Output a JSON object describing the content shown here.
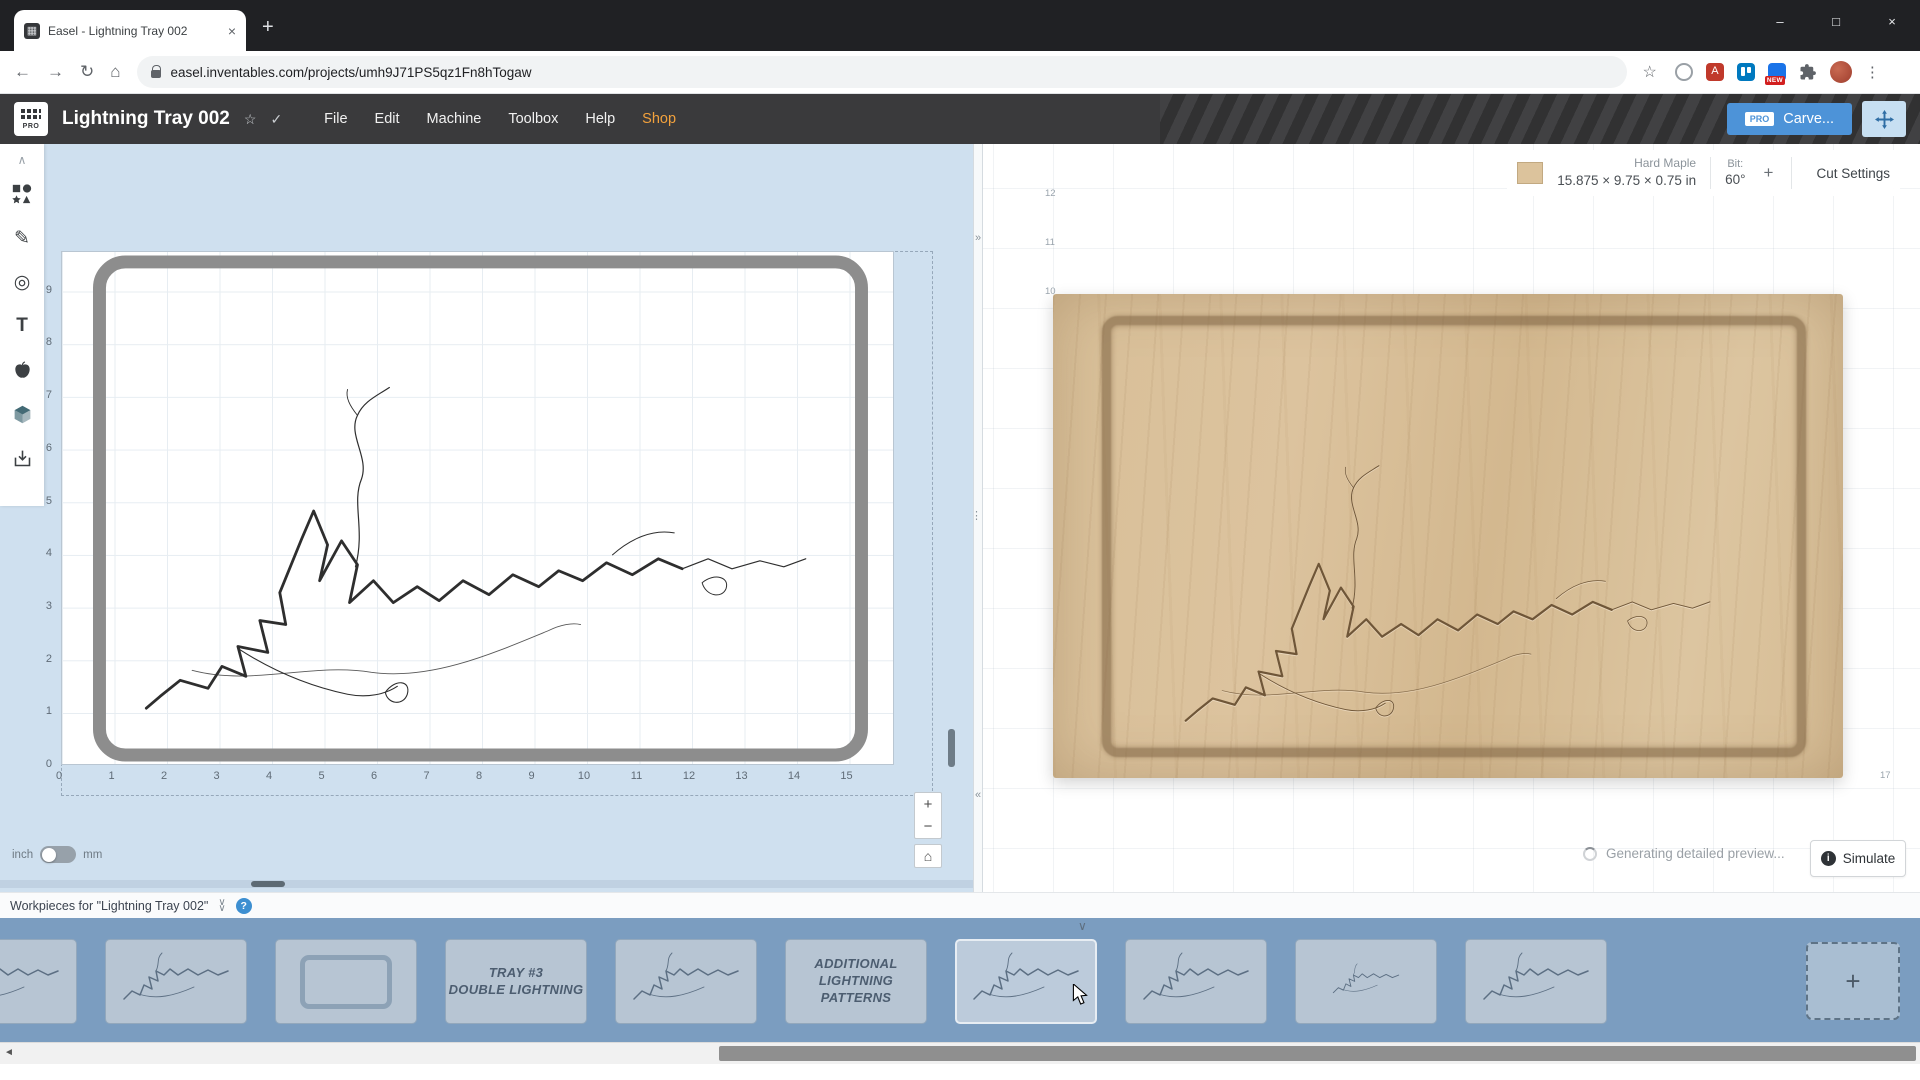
{
  "browser": {
    "tab_title": "Easel - Lightning Tray 002",
    "url": "easel.inventables.com/projects/umh9J71PS5qz1Fn8hTogaw",
    "extensions_new_badge": "NEW"
  },
  "header": {
    "logo_text": "PRO",
    "project_title": "Lightning Tray 002",
    "menus": [
      "File",
      "Edit",
      "Machine",
      "Toolbox",
      "Help",
      "Shop"
    ],
    "carve": {
      "badge": "PRO",
      "label": "Carve..."
    }
  },
  "canvas": {
    "x_ticks": [
      "0",
      "1",
      "2",
      "3",
      "4",
      "5",
      "6",
      "7",
      "8",
      "9",
      "10",
      "11",
      "12",
      "13",
      "14",
      "15"
    ],
    "y_ticks": [
      "0",
      "1",
      "2",
      "3",
      "4",
      "5",
      "6",
      "7",
      "8",
      "9"
    ],
    "units": {
      "left": "inch",
      "right": "mm"
    }
  },
  "preview": {
    "material": {
      "name": "Hard Maple",
      "dimensions": "15.875 × 9.75 × 0.75 in"
    },
    "bit": {
      "label": "Bit:",
      "value": "60°",
      "add": "+"
    },
    "cut_settings": "Cut Settings",
    "ruler_y": [
      "12",
      "11",
      "10"
    ],
    "ruler_x_end": "17",
    "status": "Generating detailed preview...",
    "simulate": "Simulate"
  },
  "workpieces": {
    "title": "Workpieces for \"Lightning Tray 002\"",
    "items": [
      {
        "kind": "lightning",
        "partial": true
      },
      {
        "kind": "lightning"
      },
      {
        "kind": "outline"
      },
      {
        "kind": "label",
        "lines": [
          "TRAY #3",
          "DOUBLE LIGHTNING"
        ]
      },
      {
        "kind": "lightning"
      },
      {
        "kind": "label",
        "lines": [
          "ADDITIONAL",
          "LIGHTNING",
          "PATTERNS"
        ]
      },
      {
        "kind": "lightning",
        "selected": true
      },
      {
        "kind": "lightning"
      },
      {
        "kind": "lightning-small"
      },
      {
        "kind": "lightning"
      }
    ],
    "add_label": "+"
  },
  "icons": {
    "favicon": "▦",
    "close": "×",
    "new_tab": "+",
    "minimize": "–",
    "maximize": "□",
    "back": "←",
    "forward": "→",
    "refresh": "↻",
    "home": "⌂",
    "bookmark": "☆",
    "menu_dots": "⋮",
    "favorite": "☆",
    "saved": "✓",
    "collapse_up": "∧",
    "chevron_right": "»",
    "chevron_left": "«",
    "drag_handle": "⋮⋮",
    "caret_down": "∨",
    "help": "?",
    "info": "i",
    "zoom_in": "+",
    "zoom_out": "−",
    "home_view": "⌂",
    "scroll_left_arrow": "◄",
    "pen": "✎",
    "drill": "◎",
    "text_tool": "T",
    "acrobat": "A"
  },
  "colors": {
    "accent_blue": "#4d93d8",
    "shop_orange": "#f2a13c",
    "canvas_bg": "#cfe0ef",
    "strip_bg": "#7b9dc0",
    "wood": "#d9c09a"
  }
}
